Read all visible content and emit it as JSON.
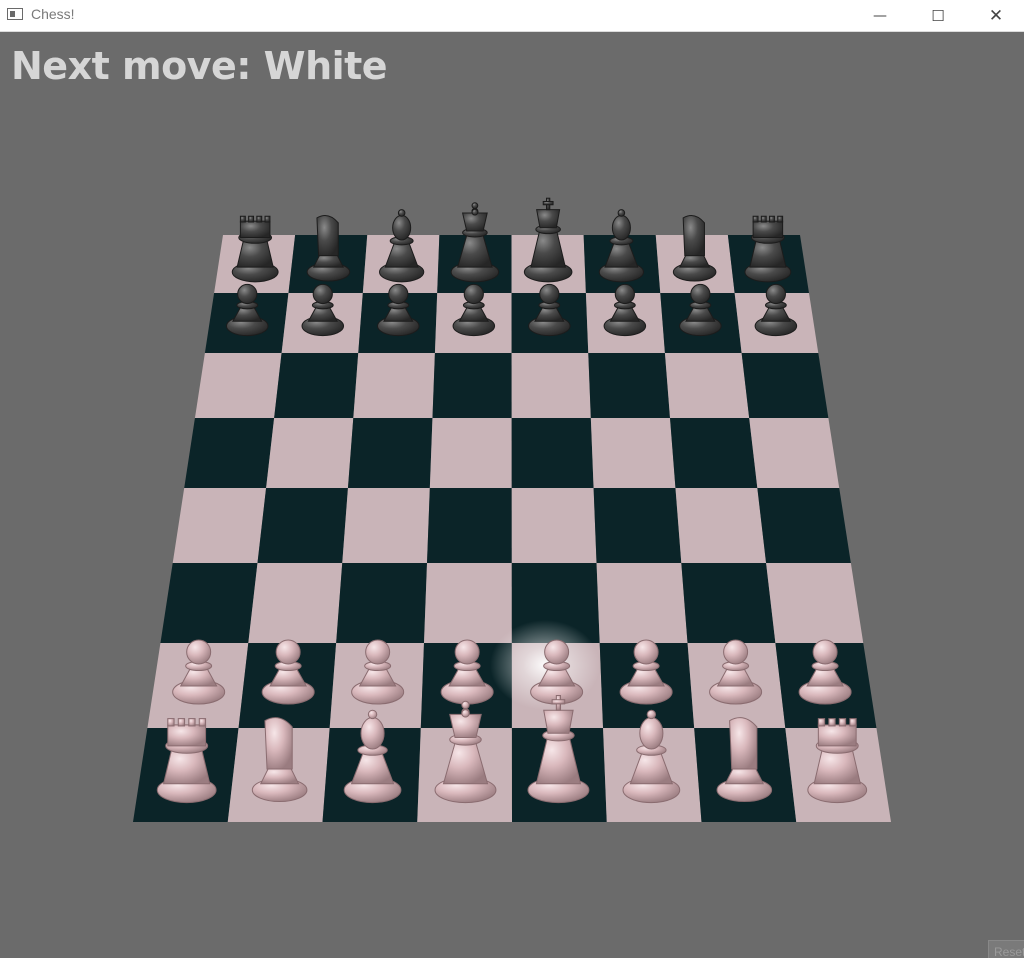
{
  "window": {
    "title": "Chess!",
    "minimize_glyph": "—",
    "maximize_glyph": "☐",
    "close_glyph": "✕"
  },
  "status": {
    "next_move_text": "Next move: White"
  },
  "reset_button": {
    "label": "Reset"
  },
  "colors": {
    "background": "#6b6b6b",
    "light_square": "#c9b4b8",
    "dark_square": "#0b2428",
    "white_piece": "#d8b4b8",
    "black_piece": "#444444"
  },
  "board": {
    "black_back_rank": [
      "rook",
      "knight",
      "bishop",
      "queen",
      "king",
      "bishop",
      "knight",
      "rook"
    ],
    "black_pawns": [
      "pawn",
      "pawn",
      "pawn",
      "pawn",
      "pawn",
      "pawn",
      "pawn",
      "pawn"
    ],
    "white_pawns": [
      "pawn",
      "pawn",
      "pawn",
      "pawn",
      "pawn",
      "pawn",
      "pawn",
      "pawn"
    ],
    "white_back_rank": [
      "rook",
      "knight",
      "bishop",
      "queen",
      "king",
      "bishop",
      "knight",
      "rook"
    ]
  }
}
